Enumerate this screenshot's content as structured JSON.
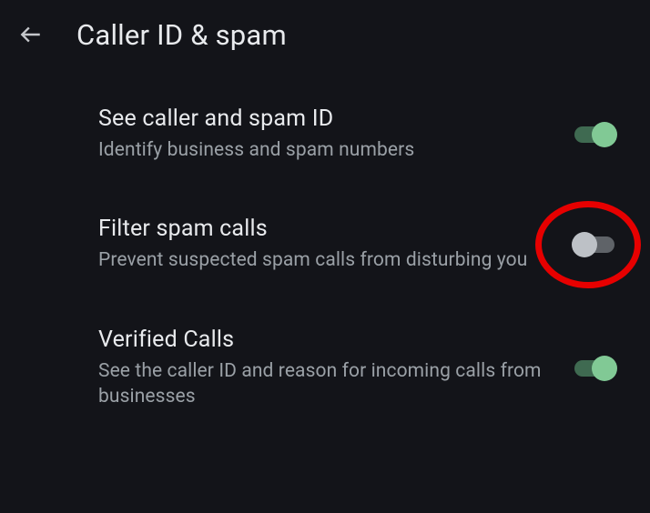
{
  "header": {
    "title": "Caller ID & spam"
  },
  "settings": {
    "see_caller_id": {
      "title": "See caller and spam ID",
      "subtitle": "Identify business and spam numbers",
      "enabled": true
    },
    "filter_spam": {
      "title": "Filter spam calls",
      "subtitle": "Prevent suspected spam calls from disturbing you",
      "enabled": false
    },
    "verified_calls": {
      "title": "Verified Calls",
      "subtitle": "See the caller ID and reason for incoming calls from businesses",
      "enabled": true
    }
  }
}
